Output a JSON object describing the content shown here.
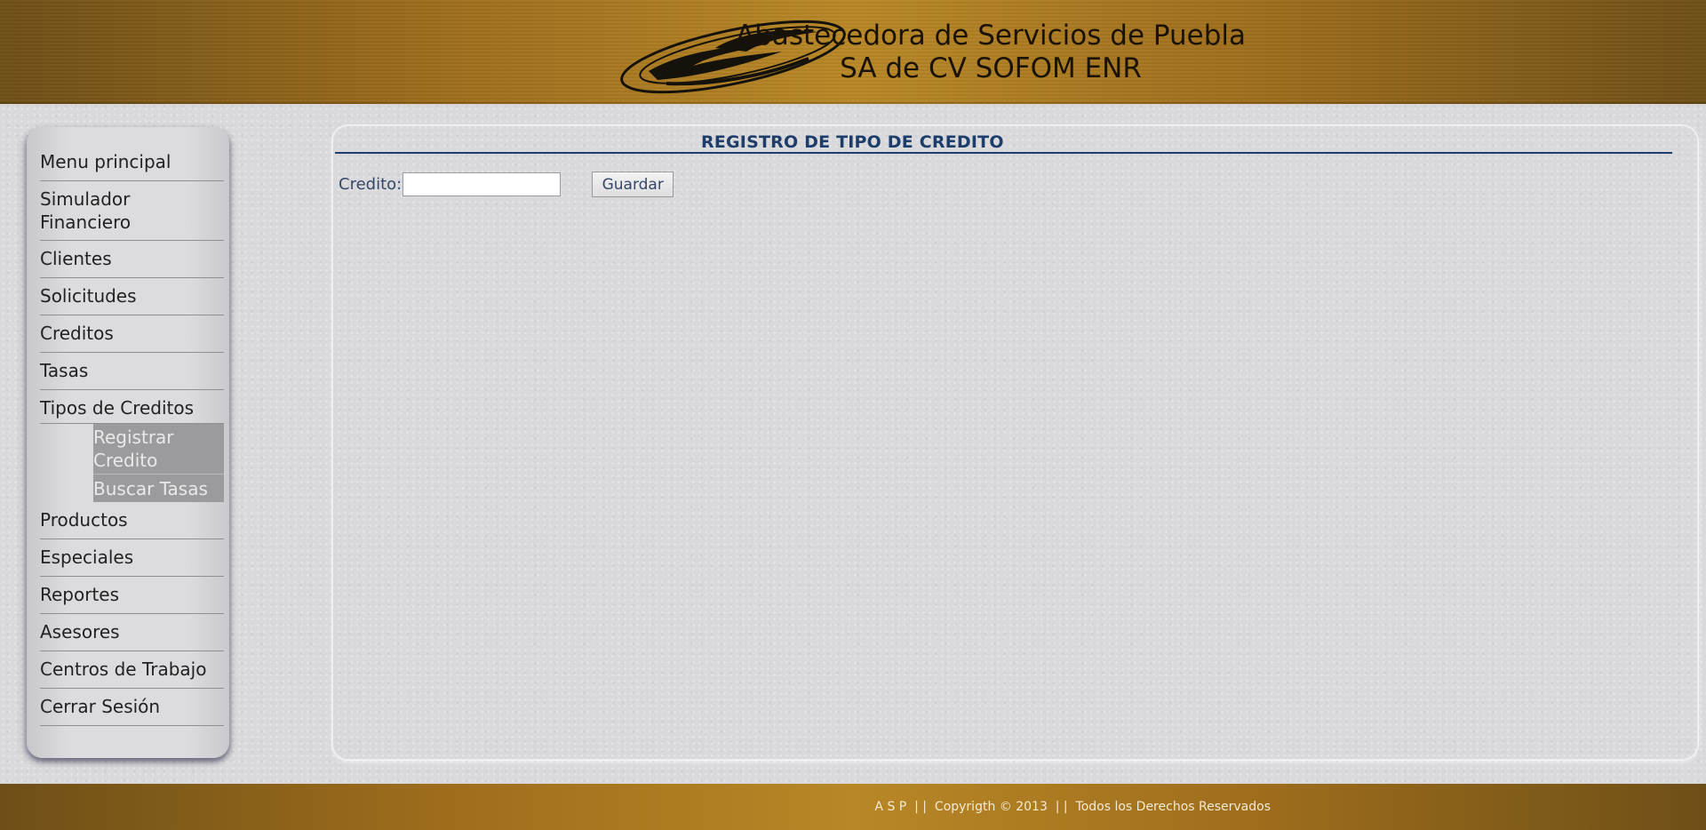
{
  "header": {
    "title_line1": "Abastecedora de Servicios de Puebla",
    "title_line2": "SA de CV SOFOM ENR"
  },
  "sidebar": {
    "items": [
      {
        "label": "Menu principal"
      },
      {
        "label": "Simulador Financiero"
      },
      {
        "label": "Clientes"
      },
      {
        "label": "Solicitudes"
      },
      {
        "label": "Creditos"
      },
      {
        "label": "Tasas"
      },
      {
        "label": "Tipos de Creditos"
      },
      {
        "label": "Productos"
      },
      {
        "label": "Especiales"
      },
      {
        "label": "Reportes"
      },
      {
        "label": "Asesores"
      },
      {
        "label": "Centros de Trabajo"
      },
      {
        "label": "Cerrar Sesión"
      }
    ],
    "submenu": [
      {
        "label": "Registrar Credito"
      },
      {
        "label": "Buscar Tasas"
      }
    ]
  },
  "main": {
    "title": "REGISTRO DE TIPO DE CREDITO",
    "credito_label": "Credito:",
    "credito_value": "",
    "save_label": "Guardar"
  },
  "footer": {
    "text": "A S P  | |  Copyrigth © 2013  | |  Todos los Derechos Reservados"
  },
  "colors": {
    "header_gold": "#b88726",
    "title_blue": "#1d3d6a",
    "submenu_gray": "#9b9b9d"
  }
}
